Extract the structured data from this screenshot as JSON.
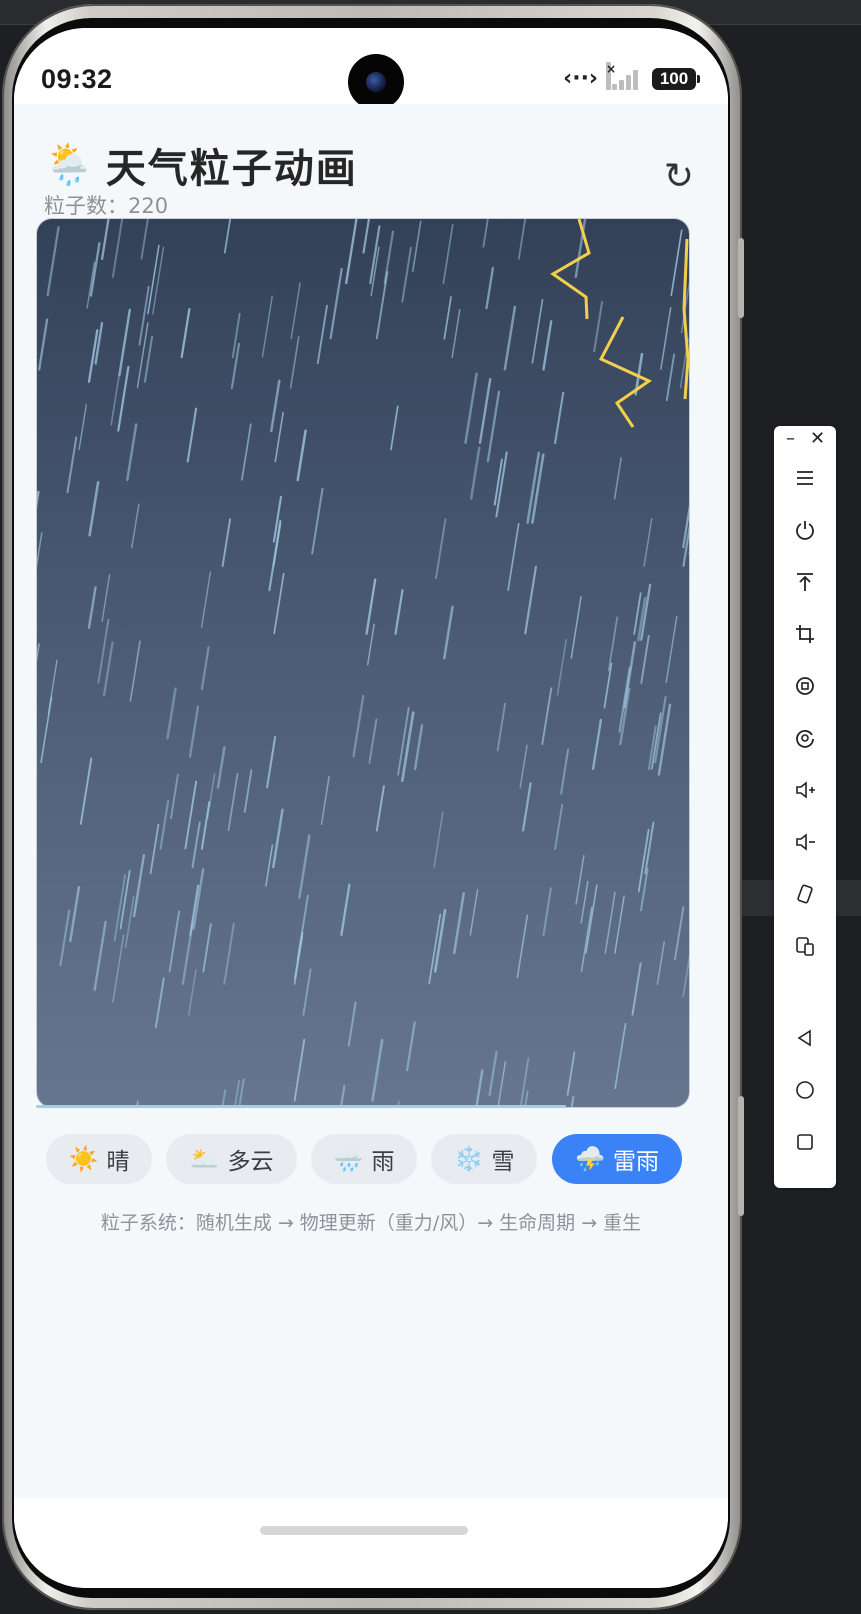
{
  "status_bar": {
    "time": "09:32",
    "battery": "100",
    "icons": [
      "camera-icon",
      "data-sync-icon",
      "signal-icon",
      "battery-icon"
    ]
  },
  "header": {
    "title_emoji": "🌦️",
    "title": "天气粒子动画",
    "particle_count_label": "粒子数：",
    "particle_count": "220",
    "refresh_glyph": "↻"
  },
  "weather_modes": [
    {
      "icon": "☀️",
      "label": "晴",
      "active": false
    },
    {
      "icon": "🌥️",
      "label": "多云",
      "active": false
    },
    {
      "icon": "🌧️",
      "label": "雨",
      "active": false
    },
    {
      "icon": "❄️",
      "label": "雪",
      "active": false
    },
    {
      "icon": "⛈️",
      "label": "雷雨",
      "active": true
    }
  ],
  "footer_note": "粒子系统：随机生成 → 物理更新（重力/风）→ 生命周期 → 重生",
  "colors": {
    "accent": "#3b82f6",
    "sky_top": "#334158",
    "sky_bottom": "#65768e",
    "rain": "#9fc3dd",
    "lightning": "#f2d04b"
  },
  "emulator_toolbar": {
    "window_controls": [
      "minimize-icon",
      "close-icon"
    ],
    "buttons": [
      "menu-icon",
      "power-icon",
      "pin-top-icon",
      "crop-icon",
      "screenshot-icon",
      "record-icon",
      "volume-up-icon",
      "volume-down-icon",
      "rotate-icon",
      "multi-device-icon",
      "back-icon",
      "home-icon",
      "recents-icon"
    ]
  }
}
